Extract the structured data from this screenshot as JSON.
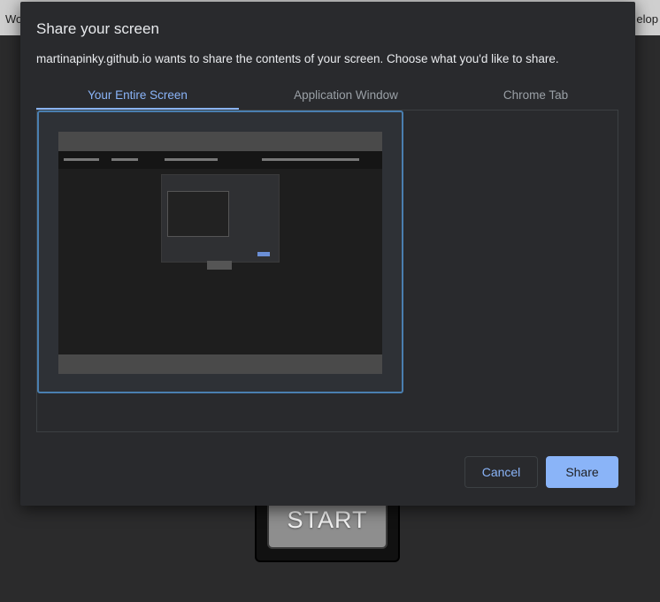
{
  "background": {
    "topbar_left": "Wo",
    "topbar_right": "elop",
    "start_button_label": "START"
  },
  "dialog": {
    "title": "Share your screen",
    "description": "martinapinky.github.io wants to share the contents of your screen. Choose what you'd like to share.",
    "tabs": [
      {
        "label": "Your Entire Screen",
        "active": true
      },
      {
        "label": "Application Window",
        "active": false
      },
      {
        "label": "Chrome Tab",
        "active": false
      }
    ],
    "cancel_label": "Cancel",
    "share_label": "Share"
  },
  "colors": {
    "accent": "#8ab4f8",
    "dialog_bg": "#292a2d",
    "selection_border": "#4a7fb0"
  }
}
